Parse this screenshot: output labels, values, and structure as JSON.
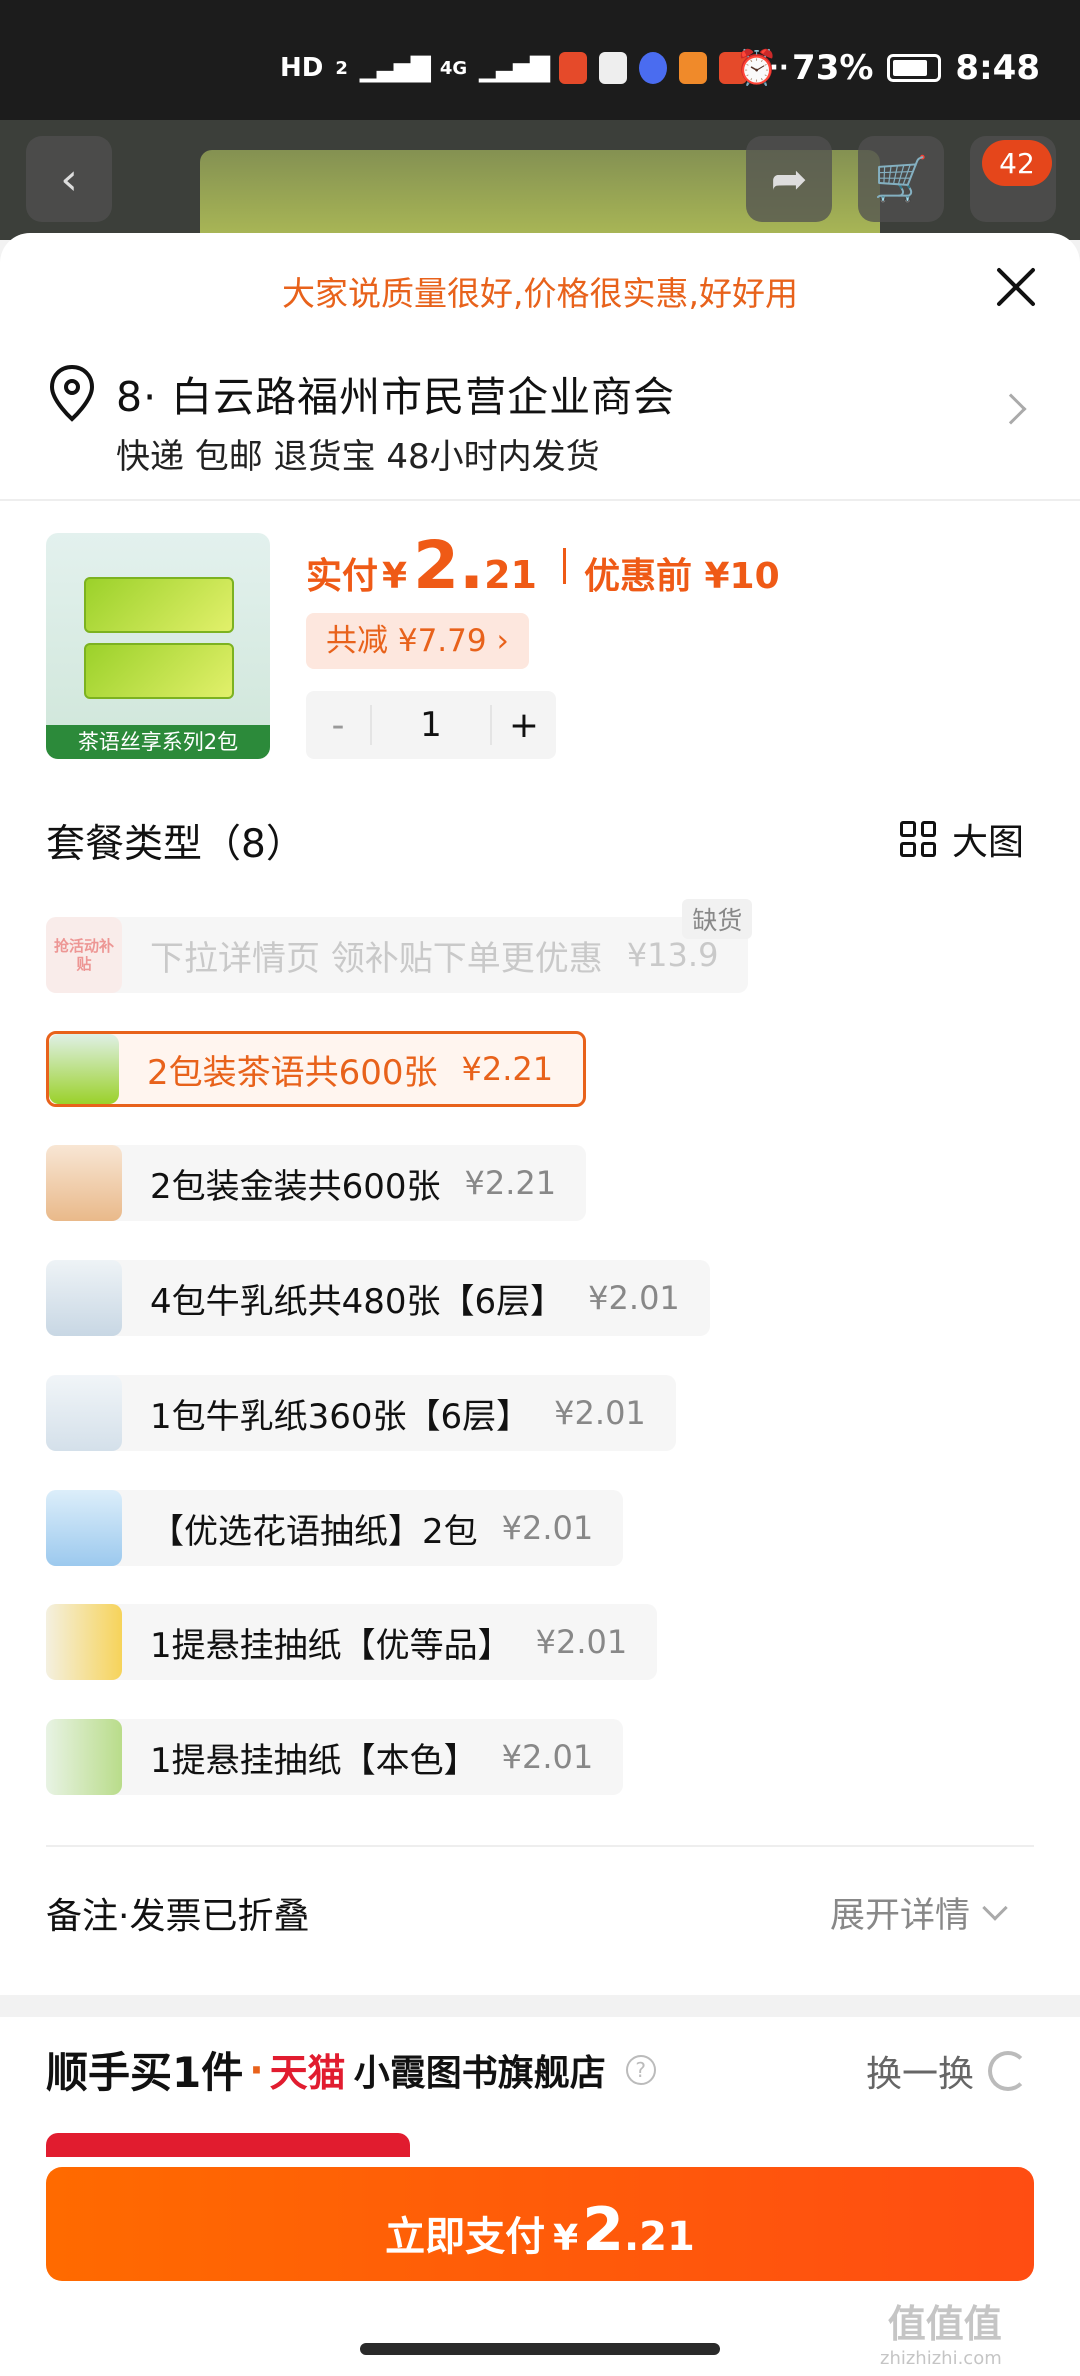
{
  "status_bar": {
    "hd": "HD",
    "sim": "2",
    "network": "4G",
    "more": "···",
    "battery": "73%",
    "time": "8:48"
  },
  "top_bar": {
    "cart_badge": "42"
  },
  "banner": "大家说质量很好,价格很实惠,好好用",
  "address": {
    "line1": "8· 白云路福州市民营企业商会",
    "line2": "快递 包邮 退货宝 48小时内发货"
  },
  "product": {
    "thumb_label": "茶语丝享系列2包",
    "price_label": "实付",
    "currency": "¥",
    "price_int": "2.",
    "price_dec": "21",
    "before_label": "优惠前 ¥10",
    "discount_label": "共减 ¥7.79 ›",
    "quantity": "1",
    "minus": "-",
    "plus": "+"
  },
  "package": {
    "title": "套餐类型（8）",
    "bigview_label": "大图",
    "options": [
      {
        "name": "下拉详情页 领补贴下单更优惠",
        "price": "¥13.9",
        "badge": "缺货",
        "thumb_text": "抢活动补贴"
      },
      {
        "name": "2包装茶语共600张",
        "price": "¥2.21"
      },
      {
        "name": "2包装金装共600张",
        "price": "¥2.21"
      },
      {
        "name": "4包牛乳纸共480张【6层】",
        "price": "¥2.01"
      },
      {
        "name": "1包牛乳纸360张【6层】",
        "price": "¥2.01"
      },
      {
        "name": "【优选花语抽纸】2包",
        "price": "¥2.01"
      },
      {
        "name": "1提悬挂抽纸【优等品】",
        "price": "¥2.01"
      },
      {
        "name": "1提悬挂抽纸【本色】",
        "price": "¥2.01"
      }
    ]
  },
  "remark": {
    "label": "备注·发票已折叠",
    "expand": "展开详情"
  },
  "addon": {
    "title": "顺手买1件",
    "dot": "·",
    "tmall": "天猫",
    "shop": "小霞图书旗舰店",
    "help": "?",
    "swap": "换一换"
  },
  "pay": {
    "label": "立即支付",
    "currency": "¥",
    "int": "2",
    "dec": ".21"
  },
  "watermark": {
    "main": "值值值",
    "sub": "zhizhizhi.com"
  },
  "colors": {
    "accent": "#e8621b",
    "price": "#ef5a16",
    "pay_button": "#ff5a0a",
    "tmall": "#e11c2f"
  }
}
